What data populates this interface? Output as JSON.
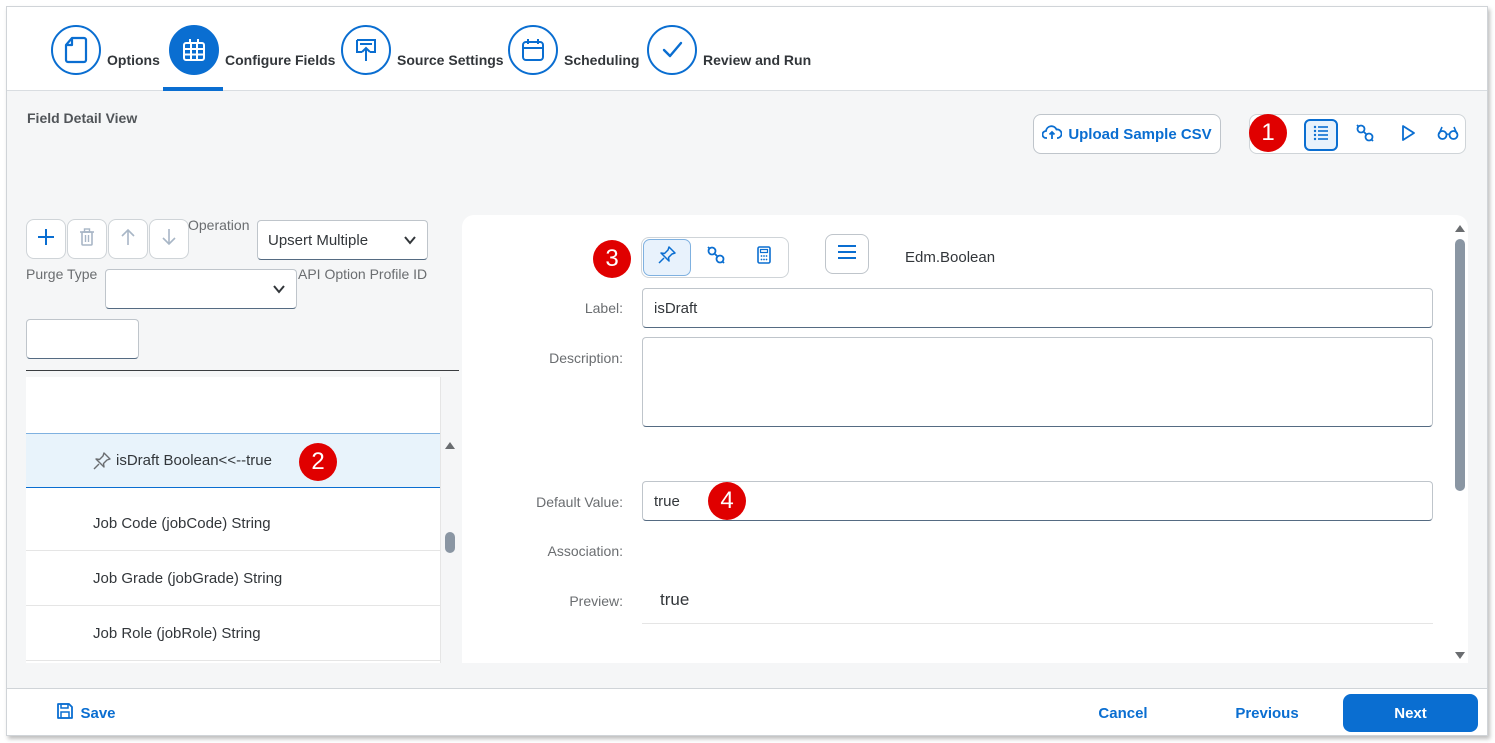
{
  "wizard": {
    "steps": [
      {
        "label": "Options",
        "icon": "document-icon"
      },
      {
        "label": "Configure Fields",
        "icon": "table-grid-icon"
      },
      {
        "label": "Source Settings",
        "icon": "upload-icon"
      },
      {
        "label": "Scheduling",
        "icon": "calendar-icon"
      },
      {
        "label": "Review and Run",
        "icon": "checkmark-icon"
      }
    ],
    "active_step": "Configure Fields"
  },
  "header": {
    "section_title": "Field Detail View",
    "upload_label": "Upload Sample CSV"
  },
  "badges": [
    "1",
    "2",
    "3",
    "4"
  ],
  "left": {
    "operation_label": "Operation",
    "operation_value": "Upsert Multiple",
    "purge_type_label": "Purge Type",
    "purge_type_value": "",
    "api_option_label": "API Option Profile ID",
    "api_option_value": "",
    "fields": [
      {
        "label": "isDraft Boolean<<--true",
        "pinned": true,
        "selected": true
      },
      {
        "label": "Job Code (jobCode) String",
        "pinned": false,
        "selected": false
      },
      {
        "label": "Job Grade (jobGrade) String",
        "pinned": false,
        "selected": false
      },
      {
        "label": "Job Role (jobRole) String",
        "pinned": false,
        "selected": false
      }
    ]
  },
  "detail": {
    "type": "Edm.Boolean",
    "label_label": "Label:",
    "label_value": "isDraft",
    "description_label": "Description:",
    "description_value": "",
    "default_value_label": "Default Value:",
    "default_value": "true",
    "association_label": "Association:",
    "preview_label": "Preview:",
    "preview_value": "true"
  },
  "footer": {
    "save": "Save",
    "cancel": "Cancel",
    "previous": "Previous",
    "next": "Next"
  },
  "colors": {
    "accent": "#0a6ed1",
    "badge": "#e00000",
    "selected_row": "#e8f3fb"
  }
}
